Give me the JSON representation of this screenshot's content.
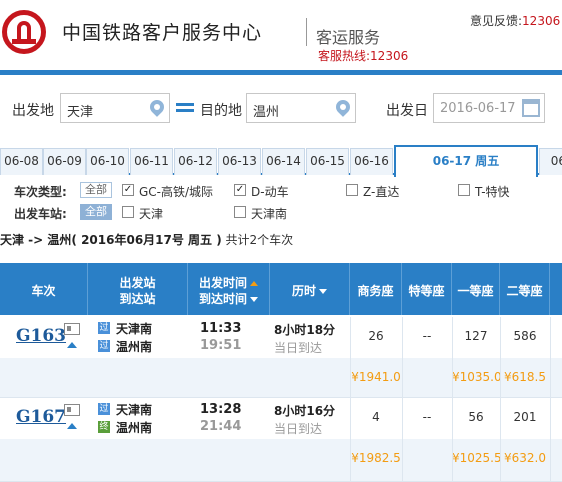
{
  "header": {
    "site_title": "中国铁路客户服务中心",
    "site_sub": "客运服务",
    "hotline": "客服热线:12306",
    "feedback_label": "意见反馈:",
    "feedback_num": "12306"
  },
  "search": {
    "from_label": "出发地",
    "from_value": "天津",
    "to_label": "目的地",
    "to_value": "温州",
    "date_label": "出发日",
    "date_value": "2016-06-17"
  },
  "date_tabs": [
    "06-08",
    "06-09",
    "06-10",
    "06-11",
    "06-12",
    "06-13",
    "06-14",
    "06-15",
    "06-16",
    "06-17 周五",
    "06-"
  ],
  "filters": {
    "type_label": "车次类型:",
    "station_label": "出发车站:",
    "all": "全部",
    "types": [
      {
        "label": "GC-高铁/城际",
        "checked": true
      },
      {
        "label": "D-动车",
        "checked": true
      },
      {
        "label": "Z-直达",
        "checked": false
      },
      {
        "label": "T-特快",
        "checked": false
      }
    ],
    "stations": [
      {
        "label": "天津",
        "checked": false
      },
      {
        "label": "天津南",
        "checked": false
      }
    ]
  },
  "summary": {
    "route": "天津 -> 温州",
    "date": "( 2016年06月17号 周五 )",
    "count": "共计2个车次"
  },
  "table": {
    "headers": {
      "train": "车次",
      "station1": "出发站",
      "station2": "到达站",
      "time1": "出发时间",
      "time2": "到达时间",
      "duration": "历时",
      "business": "商务座",
      "special": "特等座",
      "first": "一等座",
      "second": "二等座"
    },
    "rows": [
      {
        "train": "G163",
        "from_tag": "过",
        "from": "天津南",
        "to_tag": "过",
        "to": "温州南",
        "dep": "11:33",
        "arr": "19:51",
        "duration": "8小时18分",
        "arrive_day": "当日到达",
        "business": "26",
        "special": "--",
        "first": "127",
        "second": "586",
        "business_price": "¥1941.0",
        "first_price": "¥1035.0",
        "second_price": "¥618.5"
      },
      {
        "train": "G167",
        "from_tag": "过",
        "from": "天津南",
        "to_tag": "终",
        "to": "温州南",
        "dep": "13:28",
        "arr": "21:44",
        "duration": "8小时16分",
        "arrive_day": "当日到达",
        "business": "4",
        "special": "--",
        "first": "56",
        "second": "201",
        "business_price": "¥1982.5",
        "first_price": "¥1025.5",
        "second_price": "¥632.0"
      }
    ]
  },
  "colors": {
    "brand_red": "#c5161d",
    "brand_blue": "#2a7fc6",
    "price_orange": "#f39c12"
  }
}
